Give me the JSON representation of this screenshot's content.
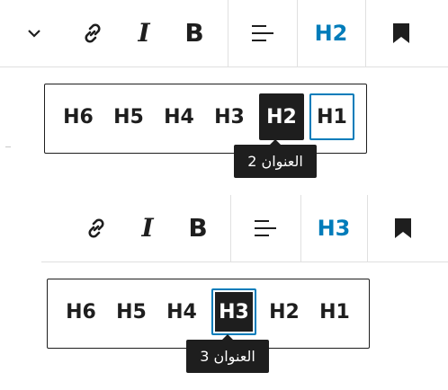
{
  "toolbar1": {
    "heading_label": "H2",
    "accent_color": "#007cba",
    "icons": [
      "chevron-down-icon",
      "link-icon",
      "italic-icon",
      "bold-icon",
      "align-icon",
      "bookmark-icon"
    ],
    "italic_glyph": "I",
    "bold_glyph": "B"
  },
  "panel1": {
    "levels": [
      "H6",
      "H5",
      "H4",
      "H3",
      "H2",
      "H1"
    ],
    "selected": "H2",
    "focused": "H1",
    "tooltip": "العنوان 2"
  },
  "toolbar2": {
    "heading_label": "H3",
    "icons": [
      "link-icon",
      "italic-icon",
      "bold-icon",
      "align-icon",
      "bookmark-icon"
    ],
    "italic_glyph": "I",
    "bold_glyph": "B"
  },
  "panel2": {
    "levels": [
      "H6",
      "H5",
      "H4",
      "H3",
      "H2",
      "H1"
    ],
    "selected": "H3",
    "focused": "H3",
    "tooltip": "العنوان 3"
  }
}
